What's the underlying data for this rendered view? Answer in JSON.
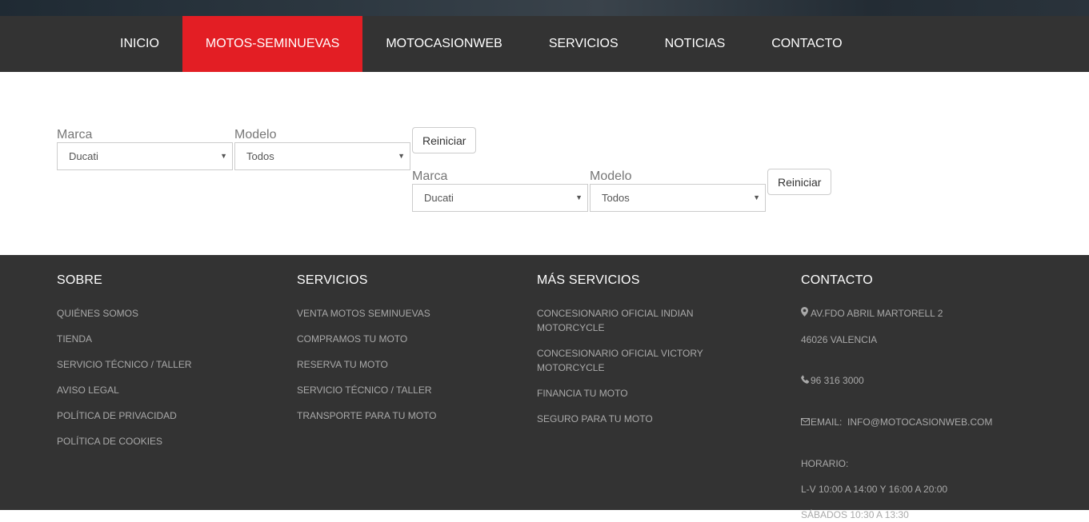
{
  "nav": {
    "items": [
      {
        "label": "INICIO"
      },
      {
        "label": "MOTOS-SEMINUEVAS",
        "active": true
      },
      {
        "label": "MOTOCASIONWEB"
      },
      {
        "label": "SERVICIOS"
      },
      {
        "label": "NOTICIAS"
      },
      {
        "label": "CONTACTO"
      }
    ],
    "accent_color": "#e31e24",
    "bg_color": "#333333"
  },
  "filters": [
    {
      "brand_label": "Marca",
      "brand_value": "Ducati",
      "model_label": "Modelo",
      "model_value": "Todos",
      "reset_label": "Reiniciar"
    },
    {
      "brand_label": "Marca",
      "brand_value": "Ducati",
      "model_label": "Modelo",
      "model_value": "Todos",
      "reset_label": "Reiniciar"
    }
  ],
  "footer": {
    "sobre": {
      "title": "SOBRE",
      "links": [
        "QUIÉNES SOMOS",
        "TIENDA",
        "SERVICIO TÉCNICO / TALLER",
        "AVISO LEGAL",
        "POLÍTICA DE PRIVACIDAD",
        "POLÍTICA DE COOKIES"
      ]
    },
    "servicios": {
      "title": "SERVICIOS",
      "links": [
        "VENTA MOTOS SEMINUEVAS",
        "COMPRAMOS TU MOTO",
        "RESERVA TU MOTO",
        "SERVICIO TÉCNICO / TALLER",
        "TRANSPORTE PARA TU MOTO"
      ]
    },
    "mas_servicios": {
      "title": "MÁS SERVICIOS",
      "links": [
        "CONCESIONARIO OFICIAL INDIAN MOTORCYCLE",
        "CONCESIONARIO OFICIAL VICTORY MOTORCYCLE",
        "FINANCIA TU MOTO",
        "SEGURO PARA TU MOTO"
      ]
    },
    "contacto": {
      "title": "CONTACTO",
      "address1": "AV.FDO ABRIL MARTORELL 2",
      "address2": "46026 VALENCIA",
      "phone": "96 316 3000",
      "email_label": "EMAIL:",
      "email": "INFO@MOTOCASIONWEB.COM",
      "hours_title": "HORARIO:",
      "hours_weekdays": "L-V 10:00 A 14:00 Y 16:00 A 20:00",
      "hours_saturday": "SÁBADOS 10:30 A 13:30"
    }
  }
}
